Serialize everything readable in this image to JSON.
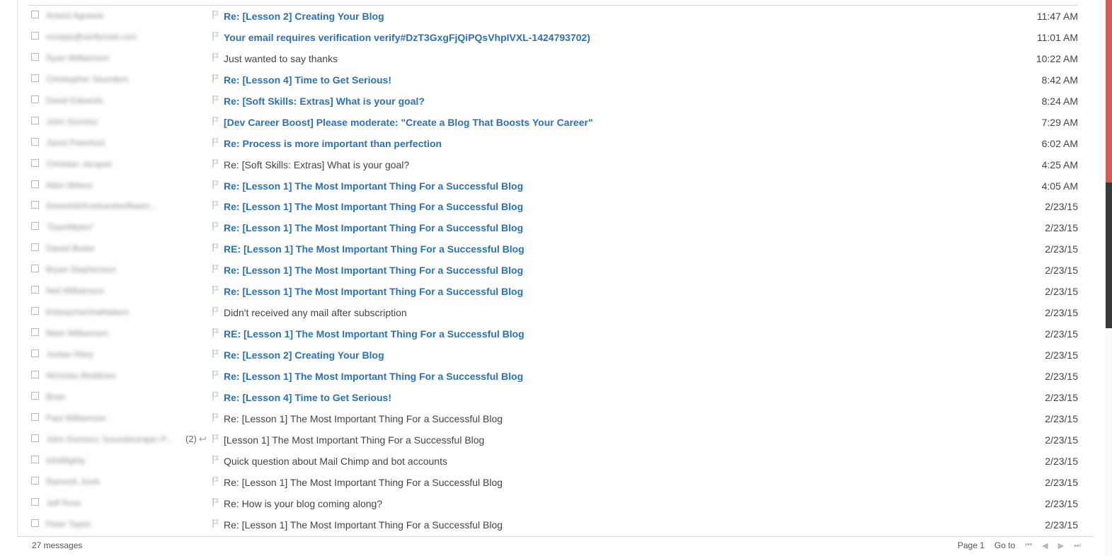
{
  "colors": {
    "unread_subject": "#2a72b5",
    "read_subject": "#444444",
    "scroll_accent": "#d65a4f",
    "scroll_thumb": "#3a3a3a"
  },
  "messages": [
    {
      "sender": "Anand Agrawal",
      "subject": "Re: [Lesson 2] Creating Your Blog",
      "time": "11:47 AM",
      "unread": true
    },
    {
      "sender": "noreply@verifymail.com",
      "subject": "Your email requires verification verify#DzT3GxgFjQiPQsVhpIVXL-1424793702)",
      "time": "11:01 AM",
      "unread": true
    },
    {
      "sender": "Ryan Williamson",
      "subject": "Just wanted to say thanks",
      "time": "10:22 AM",
      "unread": false
    },
    {
      "sender": "Christopher Saunders",
      "subject": "Re: [Lesson 4] Time to Get Serious!",
      "time": "8:42 AM",
      "unread": true
    },
    {
      "sender": "David Edwards",
      "subject": "Re: [Soft Skills: Extras] What is your goal?",
      "time": "8:24 AM",
      "unread": true
    },
    {
      "sender": "John Sonmez",
      "subject": "[Dev Career Boost] Please moderate: \"Create a Blog That Boosts Your Career\"",
      "time": "7:29 AM",
      "unread": true
    },
    {
      "sender": "Jared Peterford",
      "subject": "Re: Process is more important than perfection",
      "time": "6:02 AM",
      "unread": true
    },
    {
      "sender": "Christian Jacquet",
      "subject": "Re: [Soft Skills: Extras] What is your goal?",
      "time": "4:25 AM",
      "unread": false
    },
    {
      "sender": "Allen Wilson",
      "subject": "Re: [Lesson 1] The Most Important Thing For a Successful Blog",
      "time": "4:05 AM",
      "unread": true
    },
    {
      "sender": "theworldofcodeandsoftware...",
      "subject": "Re: [Lesson 1] The Most Important Thing For a Successful Blog",
      "time": "2/23/15",
      "unread": true
    },
    {
      "sender": "\"DaveMyles\"",
      "subject": "Re: [Lesson 1] The Most Important Thing For a Successful Blog",
      "time": "2/23/15",
      "unread": true
    },
    {
      "sender": "Daniel Burke",
      "subject": "RE: [Lesson 1] The Most Important Thing For a Successful Blog",
      "time": "2/23/15",
      "unread": true
    },
    {
      "sender": "Bryan Stephenson",
      "subject": "Re: [Lesson 1] The Most Important Thing For a Successful Blog",
      "time": "2/23/15",
      "unread": true
    },
    {
      "sender": "Neil Williamson",
      "subject": "Re: [Lesson 1] The Most Important Thing For a Successful Blog",
      "time": "2/23/15",
      "unread": true
    },
    {
      "sender": "lindsaymarshallsplace",
      "subject": "Didn't received any mail after subscription",
      "time": "2/23/15",
      "unread": false
    },
    {
      "sender": "Mark Williamson",
      "subject": "RE: [Lesson 1] The Most Important Thing For a Successful Blog",
      "time": "2/23/15",
      "unread": true
    },
    {
      "sender": "Jordan Riley",
      "subject": "Re: [Lesson 2] Creating Your Blog",
      "time": "2/23/15",
      "unread": true
    },
    {
      "sender": "Nicholas Beddows",
      "subject": "Re: [Lesson 1] The Most Important Thing For a Successful Blog",
      "time": "2/23/15",
      "unread": true
    },
    {
      "sender": "Brian",
      "subject": "Re: [Lesson 4] Time to Get Serious!",
      "time": "2/23/15",
      "unread": true
    },
    {
      "sender": "Paul Williamson",
      "subject": "Re: [Lesson 1] The Most Important Thing For a Successful Blog",
      "time": "2/23/15",
      "unread": false
    },
    {
      "sender": "John Sonmez; Soundararajan P...",
      "thread_count": "(2)",
      "replied": true,
      "subject": "[Lesson 1] The Most Important Thing For a Successful Blog",
      "time": "2/23/15",
      "unread": false
    },
    {
      "sender": "InfoMighty",
      "subject": "Quick question about Mail Chimp and bot accounts",
      "time": "2/23/15",
      "unread": false
    },
    {
      "sender": "Ramesh Joshi",
      "subject": "Re: [Lesson 1] The Most Important Thing For a Successful Blog",
      "time": "2/23/15",
      "unread": false
    },
    {
      "sender": "Jeff Ross",
      "subject": "Re: How is your blog coming along?",
      "time": "2/23/15",
      "unread": false
    },
    {
      "sender": "Peter Taylor",
      "subject": "Re: [Lesson 1] The Most Important Thing For a Successful Blog",
      "time": "2/23/15",
      "unread": false
    }
  ],
  "footer": {
    "count_label": "27 messages",
    "page_label": "Page 1",
    "goto_label": "Go to",
    "nav_icons": [
      "first-page-icon",
      "prev-page-icon",
      "next-page-icon",
      "last-page-icon"
    ]
  }
}
